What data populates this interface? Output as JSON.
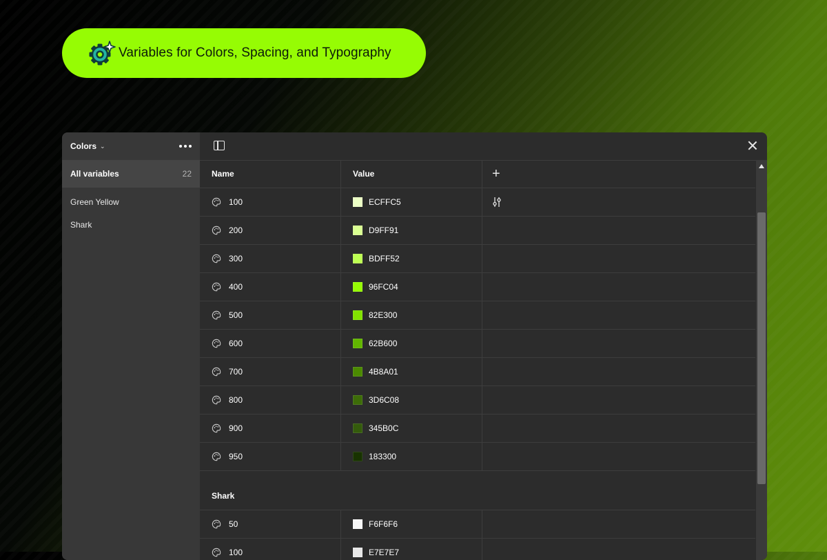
{
  "banner": {
    "text": "Variables for Colors, Spacing, and Typography",
    "icon": "sparkle-gear-icon",
    "background": "#96FC04"
  },
  "sidebar": {
    "collection": "Colors",
    "all_label": "All variables",
    "all_count": "22",
    "groups": [
      "Green Yellow",
      "Shark"
    ]
  },
  "table": {
    "headers": {
      "name": "Name",
      "value": "Value"
    },
    "rows_green": [
      {
        "name": "100",
        "value": "ECFFC5",
        "color": "#ECFFC5"
      },
      {
        "name": "200",
        "value": "D9FF91",
        "color": "#D9FF91"
      },
      {
        "name": "300",
        "value": "BDFF52",
        "color": "#BDFF52"
      },
      {
        "name": "400",
        "value": "96FC04",
        "color": "#96FC04"
      },
      {
        "name": "500",
        "value": "82E300",
        "color": "#82E300"
      },
      {
        "name": "600",
        "value": "62B600",
        "color": "#62B600"
      },
      {
        "name": "700",
        "value": "4B8A01",
        "color": "#4B8A01"
      },
      {
        "name": "800",
        "value": "3D6C08",
        "color": "#3D6C08"
      },
      {
        "name": "900",
        "value": "345B0C",
        "color": "#345B0C"
      },
      {
        "name": "950",
        "value": "183300",
        "color": "#183300"
      }
    ],
    "shark_group": "Shark",
    "rows_shark": [
      {
        "name": "50",
        "value": "F6F6F6",
        "color": "#F6F6F6"
      },
      {
        "name": "100",
        "value": "E7E7E7",
        "color": "#E7E7E7"
      }
    ]
  }
}
